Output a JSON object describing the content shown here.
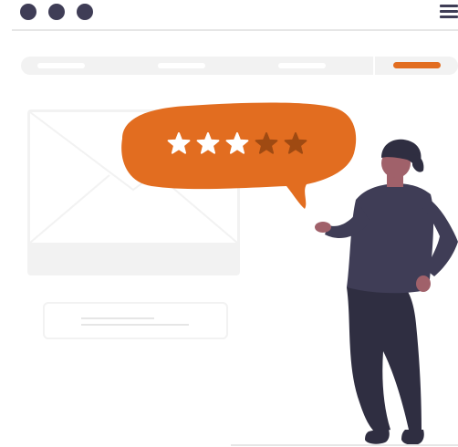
{
  "window_controls": {
    "dots": [
      "window-dot",
      "window-dot",
      "window-dot"
    ],
    "menu_icon": "hamburger-menu-icon"
  },
  "rating": {
    "filled": 3,
    "total": 5,
    "icon": "star-icon"
  },
  "illustration": {
    "envelope_icon": "envelope-icon",
    "person": "person-illustration"
  },
  "colors": {
    "accent": "#e26d20",
    "star_empty": "#9f4a12",
    "dark": "#3f3d56",
    "light_gray": "#f2f2f2",
    "line_gray": "#e6e6e6",
    "skin": "#a0616a",
    "hair": "#2f2e41"
  }
}
